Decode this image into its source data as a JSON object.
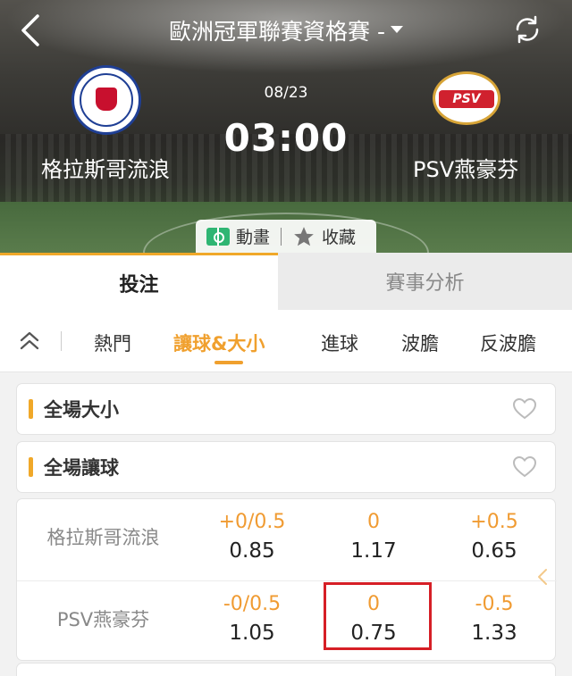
{
  "header": {
    "title": "歐洲冠軍聯賽資格賽 -",
    "date": "08/23",
    "time": "03:00",
    "home_team": "格拉斯哥流浪",
    "away_team": "PSV燕豪芬",
    "away_crest_text": "PSV",
    "animation_label": "動畫",
    "favorite_label": "收藏"
  },
  "main_tabs": [
    {
      "label": "投注",
      "active": true
    },
    {
      "label": "賽事分析",
      "active": false
    }
  ],
  "sub_tabs": [
    {
      "label": "熱門",
      "active": false
    },
    {
      "label": "讓球&大小",
      "active": true
    },
    {
      "label": "進球",
      "active": false
    },
    {
      "label": "波膽",
      "active": false
    },
    {
      "label": "反波膽",
      "active": false
    }
  ],
  "sections": {
    "total_goals": "全場大小",
    "handicap": "全場讓球"
  },
  "odds": {
    "rows": [
      {
        "team": "格拉斯哥流浪",
        "cells": [
          {
            "line": "+0/0.5",
            "price": "0.85"
          },
          {
            "line": "0",
            "price": "1.17"
          },
          {
            "line": "+0.5",
            "price": "0.65"
          }
        ]
      },
      {
        "team": "PSV燕豪芬",
        "cells": [
          {
            "line": "-0/0.5",
            "price": "1.05"
          },
          {
            "line": "0",
            "price": "0.75"
          },
          {
            "line": "-0.5",
            "price": "1.33"
          }
        ]
      }
    ]
  },
  "colors": {
    "accent": "#f0a829",
    "odds_line": "#f09b32",
    "highlight_box": "#d61f26",
    "animation_green": "#2fb573"
  },
  "icons": [
    "back-arrow-icon",
    "dropdown-caret-icon",
    "refresh-icon",
    "animation-icon",
    "star-icon",
    "collapse-up-icon",
    "heart-icon",
    "chevron-left-icon"
  ]
}
